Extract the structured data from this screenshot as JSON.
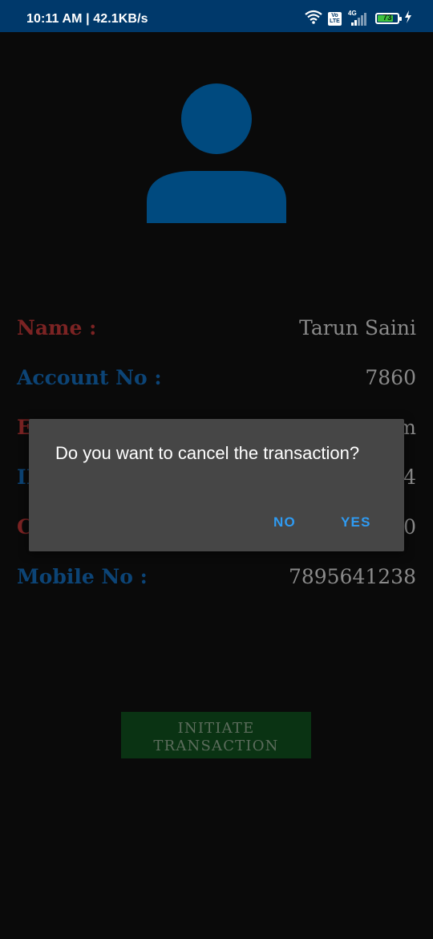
{
  "status_bar": {
    "time_speed": "10:11 AM | 42.1KB/s",
    "volte_top": "Vo",
    "volte_bottom": "LTE",
    "network": "4G",
    "battery": "73",
    "icons": [
      "wifi-icon",
      "volte-icon",
      "signal-icon",
      "battery-icon",
      "charging-icon"
    ]
  },
  "profile": {
    "avatar_icon": "person-icon",
    "avatar_color": "#004a7f"
  },
  "details": [
    {
      "label": "Name :",
      "value": "Tarun Saini"
    },
    {
      "label": "Account No :",
      "value": "7860"
    },
    {
      "label": "E",
      "value": "m"
    },
    {
      "label": "II",
      "value": "4"
    },
    {
      "label": "C",
      "value": "0"
    },
    {
      "label": "Mobile No :",
      "value": "7895641238"
    }
  ],
  "initiate_button": {
    "line1": "INITIATE",
    "line2": "TRANSACTION"
  },
  "dialog": {
    "message": "Do you want to cancel the transaction?",
    "no_label": "NO",
    "yes_label": "YES",
    "accent": "#2f9bf2"
  }
}
